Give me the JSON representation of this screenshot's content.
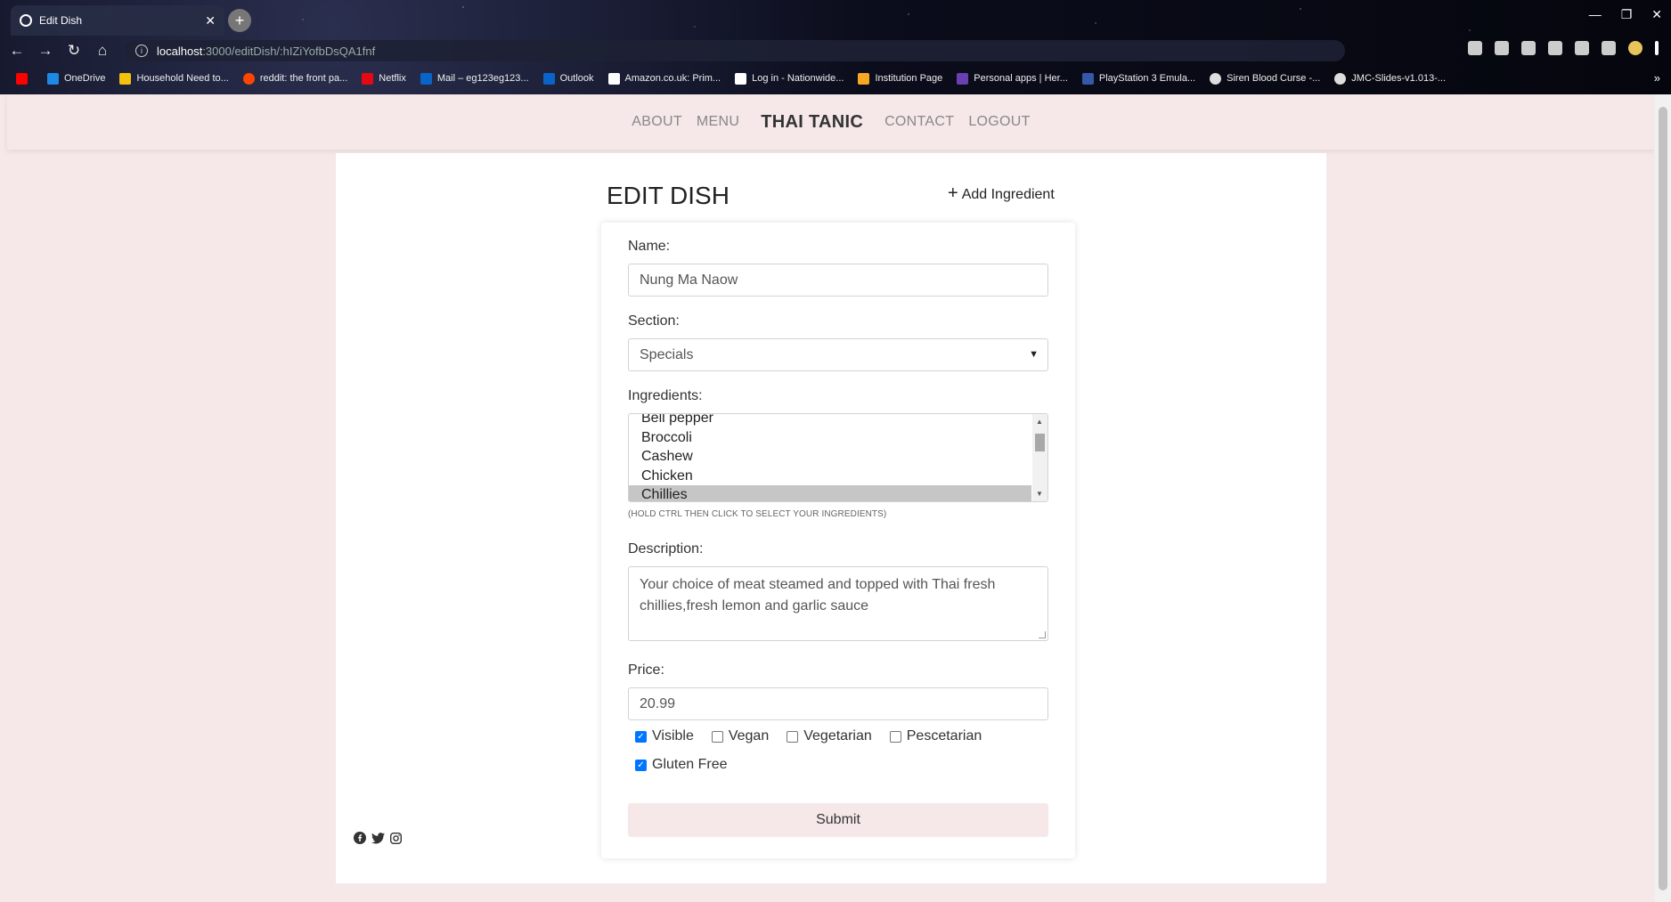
{
  "browser": {
    "tab_title": "Edit Dish",
    "url_host": "localhost",
    "url_path": ":3000/editDish/:hIZiYofbDsQA1fnf",
    "bookmarks": [
      {
        "label": "OneDrive",
        "color": "#1e88e5"
      },
      {
        "label": "Household Need to...",
        "color": "#f4c20d"
      },
      {
        "label": "reddit: the front pa...",
        "color": "#ff4500"
      },
      {
        "label": "Netflix",
        "color": "#e50914"
      },
      {
        "label": "Mail – eg123eg123...",
        "color": "#0a64c8"
      },
      {
        "label": "Outlook",
        "color": "#0a64c8"
      },
      {
        "label": "Amazon.co.uk: Prim...",
        "color": "#ffffff"
      },
      {
        "label": "Log in - Nationwide...",
        "color": "#ffffff"
      },
      {
        "label": "Institution Page",
        "color": "#f7a823"
      },
      {
        "label": "Personal apps | Her...",
        "color": "#6a3fb2"
      },
      {
        "label": "PlayStation 3 Emula...",
        "color": "#3559a8"
      },
      {
        "label": "Siren Blood Curse -...",
        "color": "#dddddd"
      },
      {
        "label": "JMC-Slides-v1.013-...",
        "color": "#dddddd"
      }
    ],
    "more": "»"
  },
  "nav": {
    "about": "ABOUT",
    "menu": "MENU",
    "brand": "THAI TANIC",
    "contact": "CONTACT",
    "logout": "LOGOUT"
  },
  "form": {
    "title": "EDIT DISH",
    "add_ingredient": "Add Ingredient",
    "name_label": "Name:",
    "name_value": "Nung Ma Naow",
    "section_label": "Section:",
    "section_value": "Specials",
    "ingredients_label": "Ingredients:",
    "ingredients": [
      "Bell pepper",
      "Broccoli",
      "Cashew",
      "Chicken",
      "Chillies"
    ],
    "ingredients_selected": "Chillies",
    "ingredients_hint": "(HOLD CTRL THEN CLICK TO SELECT YOUR INGREDIENTS)",
    "description_label": "Description:",
    "description_value": "Your choice of meat steamed and topped with Thai fresh chillies,fresh lemon and garlic sauce",
    "price_label": "Price:",
    "price_value": "20.99",
    "checks": {
      "visible": {
        "label": "Visible",
        "checked": true
      },
      "vegan": {
        "label": "Vegan",
        "checked": false
      },
      "vegetarian": {
        "label": "Vegetarian",
        "checked": false
      },
      "pescetarian": {
        "label": "Pescetarian",
        "checked": false
      },
      "gluten_free": {
        "label": "Gluten Free",
        "checked": true
      }
    },
    "submit": "Submit"
  },
  "colors": {
    "page_bg": "#f6e8e8",
    "checkbox_accent": "#0075ff"
  }
}
